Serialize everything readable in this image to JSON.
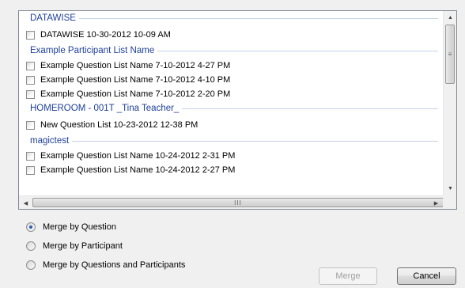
{
  "list": {
    "groups": [
      {
        "name": "DATAWISE",
        "items": [
          "DATAWISE 10-30-2012 10-09 AM"
        ]
      },
      {
        "name": "Example Participant List Name",
        "items": [
          "Example Question List Name 7-10-2012 4-27 PM",
          "Example Question List Name 7-10-2012 4-10 PM",
          "Example Question List Name 7-10-2012 2-20 PM"
        ]
      },
      {
        "name": "HOMEROOM - 001T _Tina Teacher_",
        "items": [
          "New Question List 10-23-2012 12-38 PM"
        ]
      },
      {
        "name": "magictest",
        "items": [
          "Example Question List Name 10-24-2012 2-31 PM",
          "Example Question List Name 10-24-2012 2-27 PM"
        ]
      }
    ]
  },
  "scrollbars": {
    "up_arrow": "▲",
    "down_arrow": "▼",
    "left_arrow": "◀",
    "right_arrow": "▶",
    "v_grip": "≡",
    "h_grip": "III"
  },
  "options": {
    "merge_by_question": "Merge by Question",
    "merge_by_participant": "Merge by Participant",
    "merge_by_both": "Merge by Questions and Participants",
    "selected": "merge_by_question"
  },
  "buttons": {
    "merge": "Merge",
    "cancel": "Cancel"
  }
}
